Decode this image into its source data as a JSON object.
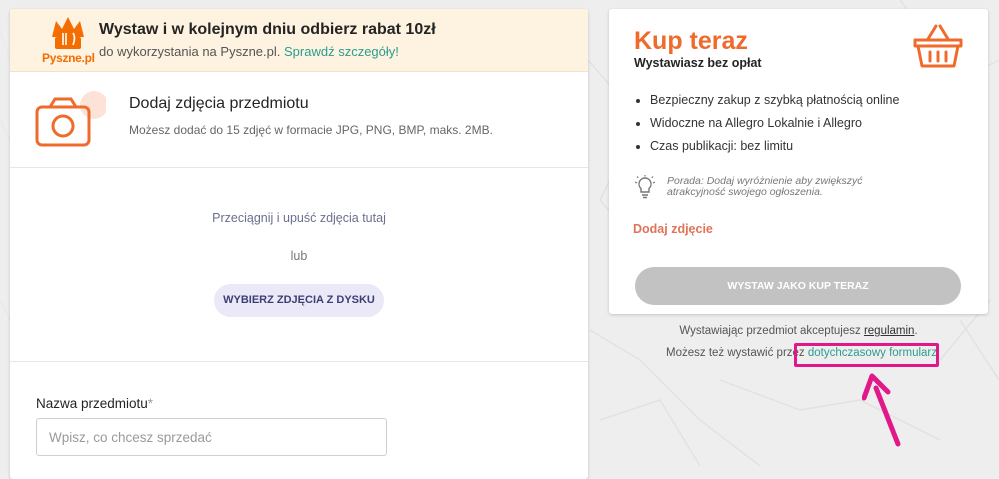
{
  "promo": {
    "logo_text": "Pyszne.pl",
    "title": "Wystaw i w kolejnym dniu odbierz rabat 10zł",
    "desc": "do wykorzystania na Pyszne.pl.",
    "link": "Sprawdź szczegóły!"
  },
  "photos": {
    "title": "Dodaj zdjęcia przedmiotu",
    "desc": "Możesz dodać do 15 zdjęć w formacie JPG, PNG, BMP, maks. 2MB.",
    "drop_text": "Przeciągnij i upuść zdjęcia tutaj",
    "or_text": "lub",
    "pick_button": "WYBIERZ ZDJĘCIA Z DYSKU"
  },
  "item_name": {
    "label": "Nazwa przedmiotu",
    "required_mark": "*",
    "placeholder": "Wpisz, co chcesz sprzedać",
    "value": ""
  },
  "buy_now": {
    "title": "Kup teraz",
    "subtitle": "Wystawiasz bez opłat",
    "features": [
      "Bezpieczny zakup z szybką płatnością online",
      "Widoczne na Allegro Lokalnie i Allegro",
      "Czas publikacji: bez limitu"
    ],
    "tip": "Porada: Dodaj wyróżnienie aby zwiększyć atrakcyjność swojego ogłoszenia.",
    "add_photo": "Dodaj zdjęcie",
    "submit_button": "WYSTAW JAKO KUP TERAZ"
  },
  "footer": {
    "accept_prefix": "Wystawiając przedmiot akceptujesz",
    "regulations_link": "regulamin",
    "accept_suffix": ".",
    "legacy_prefix": "Możesz też wystawić przez",
    "legacy_link": "dotychczasowy formularz"
  },
  "colors": {
    "accent_orange": "#ef6b2b",
    "promo_bg": "#fdf3e0",
    "link_teal": "#2a9d8f",
    "highlight_magenta": "#e0188a",
    "disabled_button": "#c2c2c2",
    "secondary_button_bg": "#ebe9f8"
  },
  "icons": [
    "pyszne-logo-icon",
    "camera-icon",
    "basket-icon",
    "lightbulb-icon",
    "annotation-arrow-icon"
  ]
}
